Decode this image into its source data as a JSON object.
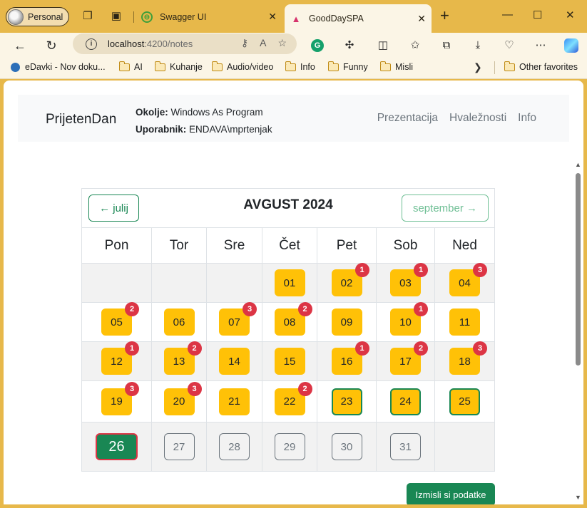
{
  "browser": {
    "profile_label": "Personal",
    "tabs": [
      {
        "title": "Swagger UI"
      },
      {
        "title": "GoodDaySPA"
      }
    ],
    "url_host": "localhost",
    "url_rest": ":4200/notes",
    "bookmarks": [
      "eDavki - Nov doku...",
      "AI",
      "Kuhanje",
      "Audio/video",
      "Info",
      "Funny",
      "Misli"
    ],
    "other_favorites": "Other favorites"
  },
  "navbar": {
    "brand": "PrijetenDan",
    "env_label": "Okolje:",
    "env_value": "Windows As Program",
    "user_label": "Uporabnik:",
    "user_value": "ENDAVA\\mprtenjak",
    "links": [
      "Prezentacija",
      "Hvaležnosti",
      "Info"
    ]
  },
  "calendar": {
    "title": "AVGUST 2024",
    "prev_label": "← julij",
    "next_label": "september →",
    "weekdays": [
      "Pon",
      "Tor",
      "Sre",
      "Čet",
      "Pet",
      "Sob",
      "Ned"
    ],
    "weeks": [
      [
        null,
        null,
        null,
        {
          "day": "01"
        },
        {
          "day": "02",
          "badge": "1"
        },
        {
          "day": "03",
          "badge": "1"
        },
        {
          "day": "04",
          "badge": "3"
        }
      ],
      [
        {
          "day": "05",
          "badge": "2"
        },
        {
          "day": "06"
        },
        {
          "day": "07",
          "badge": "3"
        },
        {
          "day": "08",
          "badge": "2"
        },
        {
          "day": "09"
        },
        {
          "day": "10",
          "badge": "1"
        },
        {
          "day": "11"
        }
      ],
      [
        {
          "day": "12",
          "badge": "1"
        },
        {
          "day": "13",
          "badge": "2"
        },
        {
          "day": "14"
        },
        {
          "day": "15"
        },
        {
          "day": "16",
          "badge": "1"
        },
        {
          "day": "17",
          "badge": "2"
        },
        {
          "day": "18",
          "badge": "3"
        }
      ],
      [
        {
          "day": "19",
          "badge": "3"
        },
        {
          "day": "20",
          "badge": "3"
        },
        {
          "day": "21"
        },
        {
          "day": "22",
          "badge": "2"
        },
        {
          "day": "23",
          "state": "green"
        },
        {
          "day": "24",
          "state": "green"
        },
        {
          "day": "25",
          "state": "green"
        }
      ],
      [
        {
          "day": "26",
          "state": "today"
        },
        {
          "day": "27",
          "state": "future"
        },
        {
          "day": "28",
          "state": "future"
        },
        {
          "day": "29",
          "state": "future"
        },
        {
          "day": "30",
          "state": "future"
        },
        {
          "day": "31",
          "state": "future"
        },
        null
      ]
    ]
  },
  "generate_button": "Izmisli si podatke",
  "colors": {
    "chrome": "#e7b84a",
    "day_yellow": "#ffc107",
    "success": "#198754",
    "danger": "#dc3545"
  }
}
